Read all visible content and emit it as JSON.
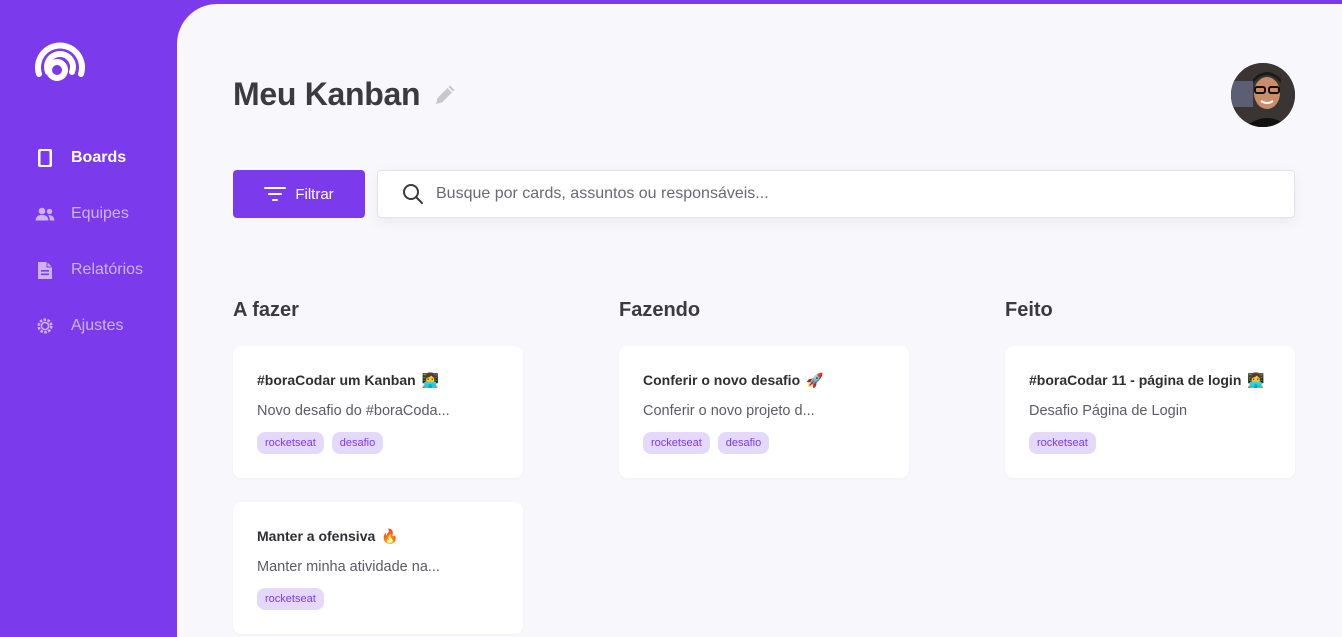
{
  "sidebar": {
    "items": [
      {
        "label": "Boards",
        "icon": "board-icon",
        "active": true
      },
      {
        "label": "Equipes",
        "icon": "team-icon",
        "active": false
      },
      {
        "label": "Relatórios",
        "icon": "document-icon",
        "active": false
      },
      {
        "label": "Ajustes",
        "icon": "settings-icon",
        "active": false
      }
    ]
  },
  "header": {
    "title": "Meu Kanban"
  },
  "toolbar": {
    "filter_label": "Filtrar",
    "search_placeholder": "Busque por cards, assuntos ou responsáveis..."
  },
  "columns": [
    {
      "title": "A fazer",
      "cards": [
        {
          "title": "#boraCodar um Kanban",
          "emoji": "👩‍💻",
          "description": "Novo desafio do #boraCoda...",
          "tags": [
            "rocketseat",
            "desafio"
          ]
        },
        {
          "title": "Manter a ofensiva",
          "emoji": "🔥",
          "description": "Manter minha atividade na...",
          "tags": [
            "rocketseat"
          ]
        }
      ]
    },
    {
      "title": "Fazendo",
      "cards": [
        {
          "title": "Conferir o novo desafio",
          "emoji": "🚀",
          "description": "Conferir o novo projeto d...",
          "tags": [
            "rocketseat",
            "desafio"
          ]
        }
      ]
    },
    {
      "title": "Feito",
      "cards": [
        {
          "title": "#boraCodar 11 - página de login",
          "emoji": "👩‍💻",
          "description": "Desafio Página de Login",
          "tags": [
            "rocketseat"
          ]
        }
      ]
    }
  ],
  "colors": {
    "brand": "#7c3aed",
    "background": "#f8f7fc",
    "tag_bg": "#e4d9fb"
  }
}
